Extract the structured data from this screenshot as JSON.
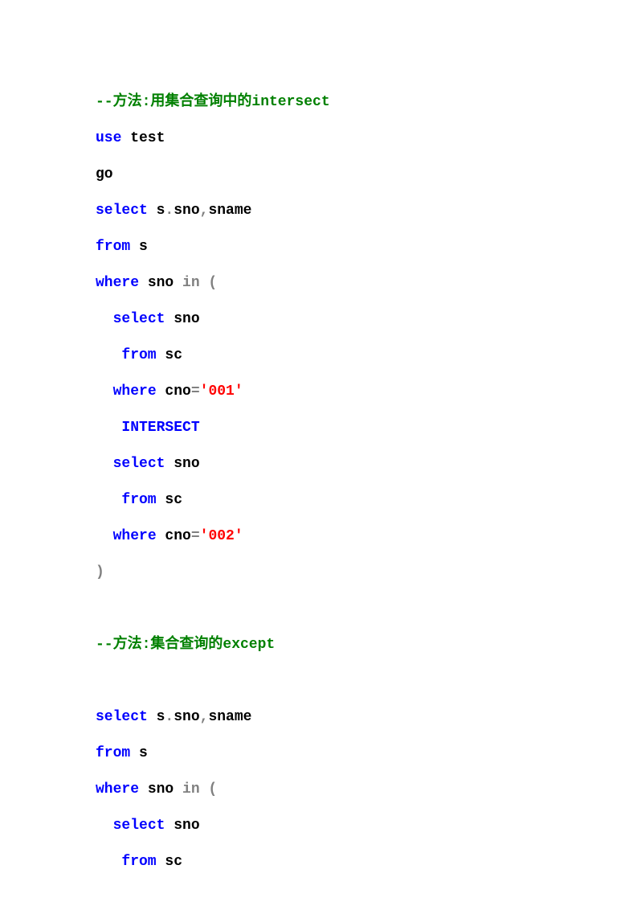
{
  "lines": [
    [
      {
        "cls": "comment",
        "text": "--方法:用集合查询中的intersect"
      }
    ],
    [
      {
        "cls": "keyword",
        "text": "use"
      },
      {
        "cls": "ident",
        "text": " test"
      }
    ],
    [
      {
        "cls": "ident",
        "text": "go"
      }
    ],
    [
      {
        "cls": "keyword",
        "text": "select"
      },
      {
        "cls": "ident",
        "text": " s"
      },
      {
        "cls": "punct",
        "text": "."
      },
      {
        "cls": "ident",
        "text": "sno"
      },
      {
        "cls": "punct",
        "text": ","
      },
      {
        "cls": "ident",
        "text": "sname"
      }
    ],
    [
      {
        "cls": "keyword",
        "text": "from"
      },
      {
        "cls": "ident",
        "text": " s"
      }
    ],
    [
      {
        "cls": "keyword",
        "text": "where"
      },
      {
        "cls": "ident",
        "text": " sno "
      },
      {
        "cls": "punct",
        "text": "in ("
      }
    ],
    [
      {
        "cls": "ident",
        "text": "  "
      },
      {
        "cls": "keyword",
        "text": "select"
      },
      {
        "cls": "ident",
        "text": " sno"
      }
    ],
    [
      {
        "cls": "ident",
        "text": "   "
      },
      {
        "cls": "keyword",
        "text": "from"
      },
      {
        "cls": "ident",
        "text": " sc"
      }
    ],
    [
      {
        "cls": "ident",
        "text": "  "
      },
      {
        "cls": "keyword",
        "text": "where"
      },
      {
        "cls": "ident",
        "text": " cno"
      },
      {
        "cls": "punct",
        "text": "="
      },
      {
        "cls": "string",
        "text": "'001'"
      }
    ],
    [
      {
        "cls": "ident",
        "text": "   "
      },
      {
        "cls": "keyword",
        "text": "INTERSECT"
      }
    ],
    [
      {
        "cls": "ident",
        "text": "  "
      },
      {
        "cls": "keyword",
        "text": "select"
      },
      {
        "cls": "ident",
        "text": " sno"
      }
    ],
    [
      {
        "cls": "ident",
        "text": "   "
      },
      {
        "cls": "keyword",
        "text": "from"
      },
      {
        "cls": "ident",
        "text": " sc"
      }
    ],
    [
      {
        "cls": "ident",
        "text": "  "
      },
      {
        "cls": "keyword",
        "text": "where"
      },
      {
        "cls": "ident",
        "text": " cno"
      },
      {
        "cls": "punct",
        "text": "="
      },
      {
        "cls": "string",
        "text": "'002'"
      }
    ],
    [
      {
        "cls": "punct",
        "text": ")"
      }
    ],
    [
      {
        "cls": "ident",
        "text": " "
      }
    ],
    [
      {
        "cls": "comment",
        "text": "--方法:集合查询的except"
      }
    ],
    [
      {
        "cls": "ident",
        "text": " "
      }
    ],
    [
      {
        "cls": "keyword",
        "text": "select"
      },
      {
        "cls": "ident",
        "text": " s"
      },
      {
        "cls": "punct",
        "text": "."
      },
      {
        "cls": "ident",
        "text": "sno"
      },
      {
        "cls": "punct",
        "text": ","
      },
      {
        "cls": "ident",
        "text": "sname"
      }
    ],
    [
      {
        "cls": "keyword",
        "text": "from"
      },
      {
        "cls": "ident",
        "text": " s"
      }
    ],
    [
      {
        "cls": "keyword",
        "text": "where"
      },
      {
        "cls": "ident",
        "text": " sno "
      },
      {
        "cls": "punct",
        "text": "in ("
      }
    ],
    [
      {
        "cls": "ident",
        "text": "  "
      },
      {
        "cls": "keyword",
        "text": "select"
      },
      {
        "cls": "ident",
        "text": " sno"
      }
    ],
    [
      {
        "cls": "ident",
        "text": "   "
      },
      {
        "cls": "keyword",
        "text": "from"
      },
      {
        "cls": "ident",
        "text": " sc"
      }
    ]
  ]
}
